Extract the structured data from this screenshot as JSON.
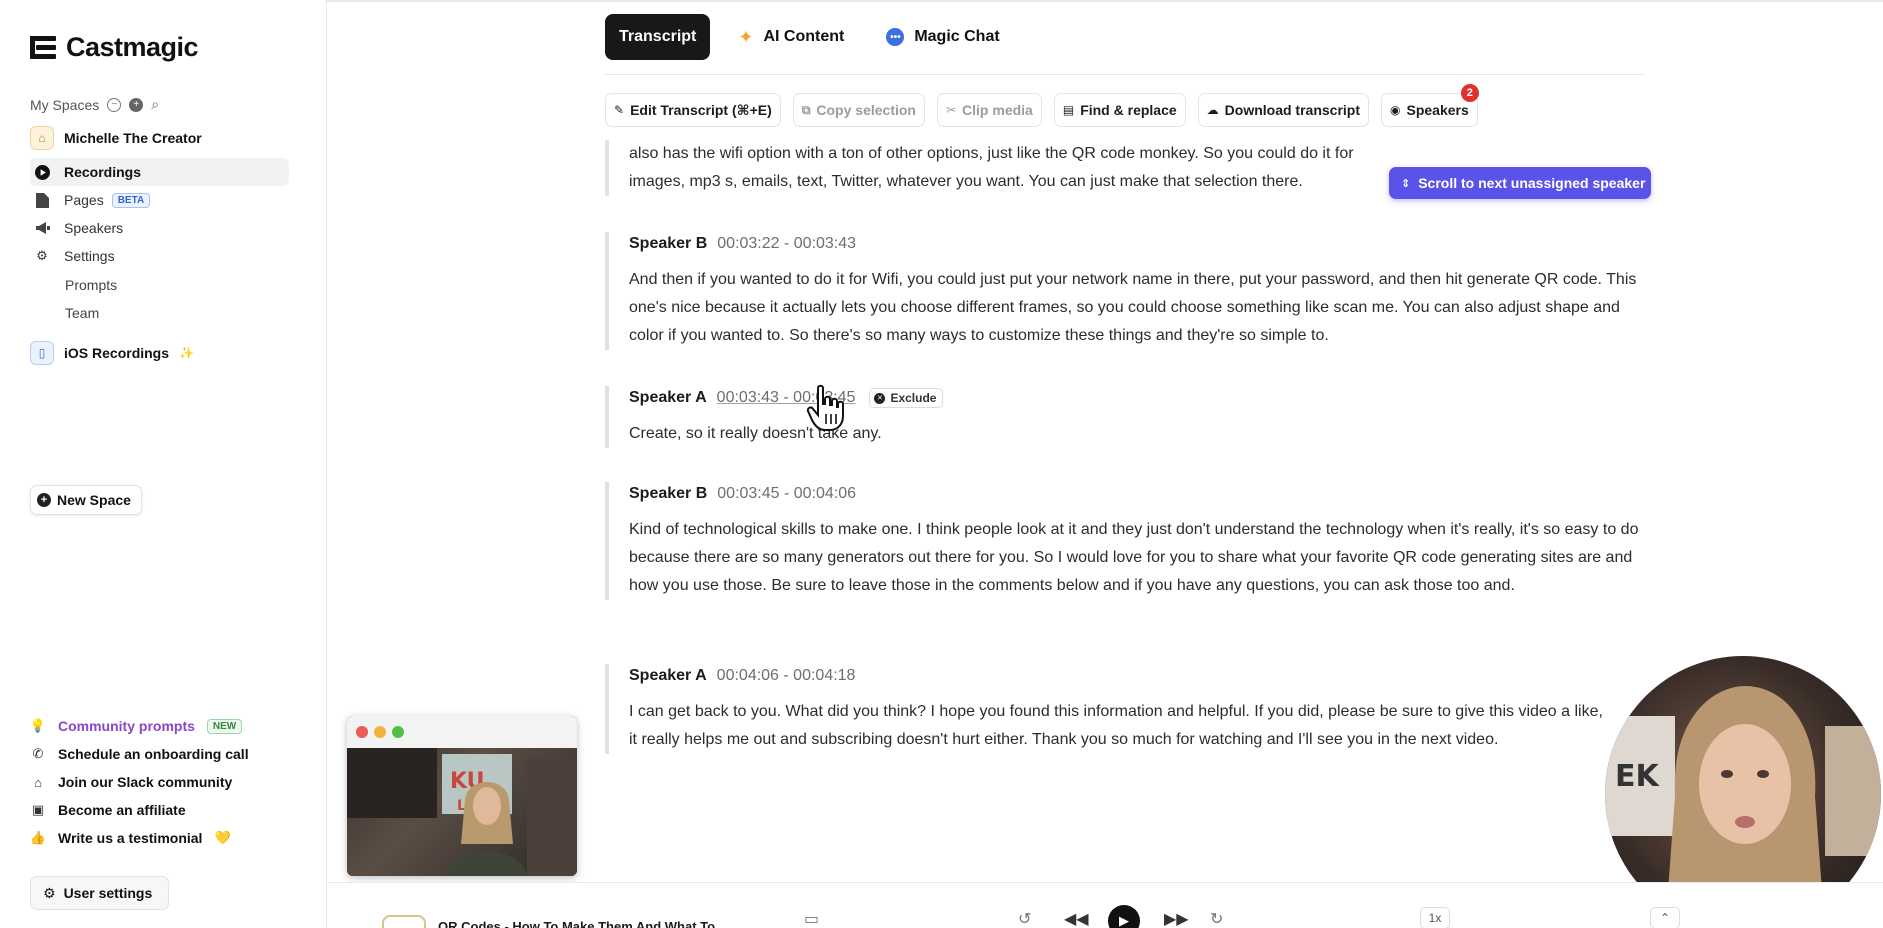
{
  "app": {
    "name": "Castmagic"
  },
  "sidebar": {
    "spaces_label": "My Spaces",
    "space_name": "Michelle The Creator",
    "nav": [
      {
        "label": "Recordings",
        "icon": "play-circle-icon",
        "active": true
      },
      {
        "label": "Pages",
        "icon": "page-icon",
        "badge": "BETA"
      },
      {
        "label": "Speakers",
        "icon": "megaphone-icon"
      },
      {
        "label": "Settings",
        "icon": "gear-icon"
      }
    ],
    "sub_items": [
      "Prompts",
      "Team"
    ],
    "ios_label": "iOS Recordings",
    "new_space_label": "New Space",
    "footer_links": [
      {
        "label": "Community prompts",
        "tag": "NEW",
        "icon": "lightbulb-icon"
      },
      {
        "label": "Schedule an onboarding call",
        "icon": "phone-icon"
      },
      {
        "label": "Join our Slack community",
        "icon": "home-icon"
      },
      {
        "label": "Become an affiliate",
        "icon": "monitor-icon"
      },
      {
        "label": "Write us a testimonial",
        "icon": "thumbs-up-icon"
      }
    ],
    "user_settings_label": "User settings"
  },
  "tabs": [
    {
      "label": "Transcript",
      "active": true
    },
    {
      "label": "AI Content",
      "icon": "sparkle-icon"
    },
    {
      "label": "Magic Chat",
      "icon": "chat-icon"
    }
  ],
  "toolbar": {
    "edit": "Edit Transcript (⌘+E)",
    "copy": "Copy selection",
    "clip": "Clip media",
    "find": "Find & replace",
    "download": "Download transcript",
    "speakers": "Speakers",
    "speakers_count": "2"
  },
  "scroll_pill_label": "Scroll to next unassigned speaker",
  "transcript": {
    "top_segment_text": "also has the wifi option with a ton of other options, just like the QR code monkey. So you could do it for images, mp3 s, emails, text, Twitter, whatever you want. You can just make that selection there.",
    "segments": [
      {
        "speaker": "Speaker B",
        "time": "00:03:22 - 00:03:43",
        "text": "And then if you wanted to do it for Wifi, you could just put your network name in there, put your password, and then hit generate QR code. This one's nice because it actually lets you choose different frames, so you could choose something like scan me. You can also adjust shape and color if you wanted to. So there's so many ways to customize these things and they're so simple to."
      },
      {
        "speaker": "Speaker A",
        "time": "00:03:43 - 00:03:45",
        "text": "Create, so it really doesn't take any.",
        "exclude_label": "Exclude"
      },
      {
        "speaker": "Speaker B",
        "time": "00:03:45 - 00:04:06",
        "text": "Kind of technological skills to make one. I think people look at it and they just don't understand the technology when it's really, it's so easy to do because there are so many generators out there for you. So I would love for you to share what your favorite QR code generating sites are and how you use those. Be sure to leave those in the comments below and if you have any questions, you can ask those too and."
      },
      {
        "speaker": "Speaker A",
        "time": "00:04:06 - 00:04:18",
        "text": "I can get back to you. What did you think? I hope you found this information and helpful. If you did, please be sure to give this video a like, it really helps me out and subscribing doesn't hurt either. Thank you so much for watching and I'll see you in the next video."
      }
    ]
  },
  "player": {
    "title": "QR Codes - How To Make Them And What To",
    "speed": "1x"
  },
  "colors": {
    "accent": "#5a53e8",
    "badge_red": "#e0322d",
    "beta_blue": "#2b67d8",
    "community_purple": "#8a46c8"
  }
}
